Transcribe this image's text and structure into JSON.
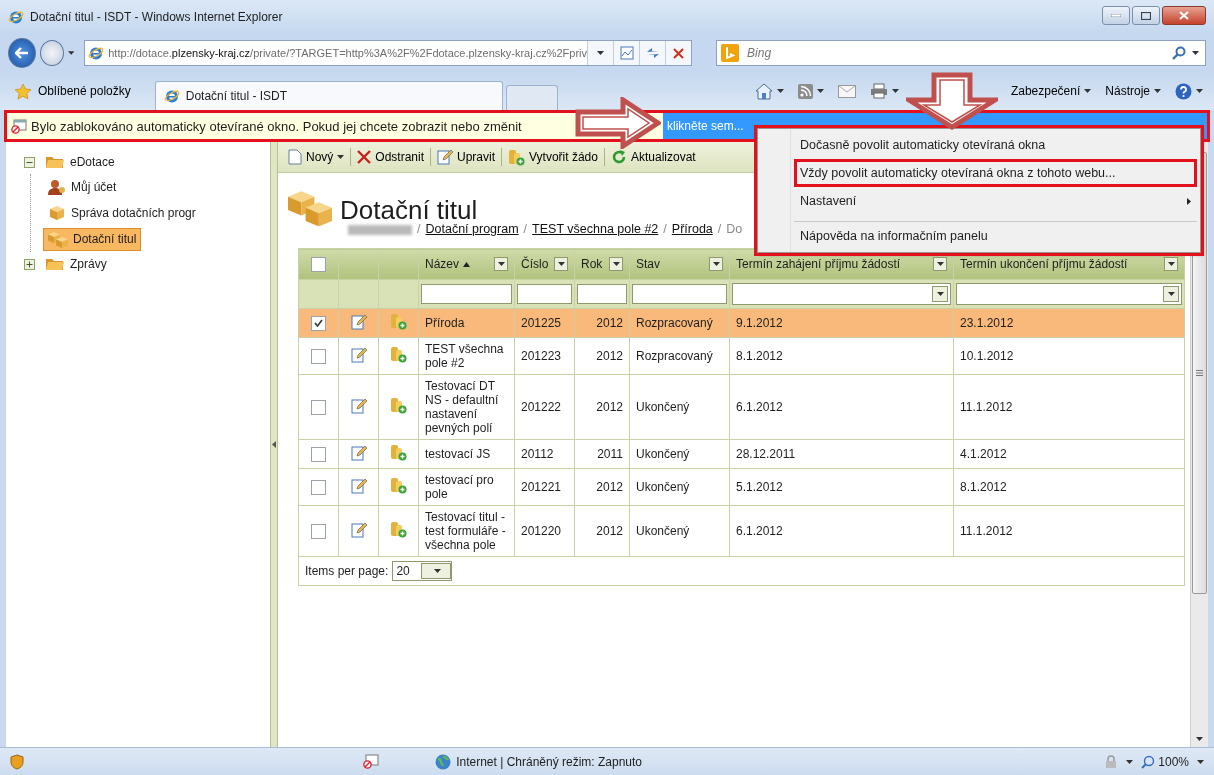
{
  "window": {
    "title": "Dotační titul - ISDT - Windows Internet Explorer"
  },
  "address_bar": {
    "url": "http://dotace.**plzensky-kraj.cz**/private/?TARGET=http%3A%2F%2Fdotace.plzensky-kraj.cz%2Fpriv"
  },
  "search": {
    "placeholder": "Bing"
  },
  "favorites": {
    "label": "Oblíbené položky"
  },
  "tabs": [
    {
      "label": "Dotační titul - ISDT",
      "selected": true
    }
  ],
  "command_bar": [
    {
      "label": "Zabezpečení"
    },
    {
      "label": "Nástroje"
    }
  ],
  "info_bar": {
    "outlined": true,
    "pointer_arrow": true,
    "message": "Bylo zablokováno automaticky otevírané okno. Pokud jej chcete zobrazit nebo změnit",
    "link": "klikněte sem..."
  },
  "context_menu": {
    "outlined": true,
    "pointer_arrow": true,
    "items": [
      {
        "label": "Dočasně povolit automaticky otevíraná okna",
        "marked": false,
        "submenu": false,
        "separator_before": false
      },
      {
        "label": "Vždy povolit automaticky otevíraná okna z tohoto webu...",
        "marked": true,
        "submenu": false,
        "separator_before": false
      },
      {
        "label": "Nastavení",
        "marked": false,
        "submenu": true,
        "separator_before": false
      },
      {
        "label": "Nápověda na informačním panelu",
        "marked": false,
        "submenu": false,
        "separator_before": true
      }
    ]
  },
  "sidebar": {
    "tree": [
      {
        "label": "eDotace",
        "kind": "folder",
        "expanded": true,
        "selected": false,
        "children": [
          {
            "label": "Můj účet",
            "kind": "user",
            "selected": false
          },
          {
            "label": "Správa dotačních progr",
            "kind": "package",
            "selected": false
          },
          {
            "label": "Dotační titul",
            "kind": "packages",
            "selected": true
          }
        ]
      },
      {
        "label": "Zprávy",
        "kind": "folder",
        "expanded": false,
        "selected": false
      }
    ]
  },
  "toolbar": [
    {
      "label": "Nový",
      "kind": "new",
      "dropdown": true
    },
    {
      "label": "Odstranit",
      "kind": "delete",
      "dropdown": false
    },
    {
      "label": "Upravit",
      "kind": "edit",
      "dropdown": false
    },
    {
      "label": "Vytvořit žádo",
      "kind": "create",
      "dropdown": false
    },
    {
      "label": "Aktualizovat",
      "kind": "refresh",
      "dropdown": false
    }
  ],
  "page": {
    "title": "Dotační titul",
    "separator": "/",
    "breadcrumb": [
      {
        "kind": "redacted"
      },
      {
        "kind": "link",
        "label": "Dotační program"
      },
      {
        "kind": "link",
        "label": "TEST všechna pole #2"
      },
      {
        "kind": "link",
        "label": "Příroda"
      },
      {
        "kind": "current",
        "label": "Do"
      }
    ]
  },
  "table": {
    "header_checkbox": {
      "checked": false
    },
    "columns": [
      {
        "label": "Název",
        "sorted_ascending": true,
        "filter_dropdown": false
      },
      {
        "label": "Číslo",
        "sorted_ascending": false,
        "filter_dropdown": false
      },
      {
        "label": "Rok",
        "sorted_ascending": false,
        "filter_dropdown": false
      },
      {
        "label": "Stav",
        "sorted_ascending": false,
        "filter_dropdown": false
      },
      {
        "label": "Termín zahájení příjmu žádostí",
        "sorted_ascending": false,
        "filter_dropdown": true
      },
      {
        "label": "Termín ukončení příjmu žádostí",
        "sorted_ascending": false,
        "filter_dropdown": true
      }
    ],
    "rows": [
      {
        "selected": true,
        "checked": true,
        "cells": [
          "Příroda",
          "201225",
          "2012",
          "Rozpracovaný",
          "9.1.2012",
          "23.1.2012"
        ]
      },
      {
        "selected": false,
        "checked": false,
        "cells": [
          "TEST všechna pole #2",
          "201223",
          "2012",
          "Rozpracovaný",
          "8.1.2012",
          "10.1.2012"
        ]
      },
      {
        "selected": false,
        "checked": false,
        "cells": [
          "Testovací DT NS - defaultní nastavení pevných polí",
          "201222",
          "2012",
          "Ukončený",
          "6.1.2012",
          "11.1.2012"
        ]
      },
      {
        "selected": false,
        "checked": false,
        "cells": [
          "testovací JS",
          "20112",
          "2011",
          "Ukončený",
          "28.12.2011",
          "4.1.2012"
        ]
      },
      {
        "selected": false,
        "checked": false,
        "cells": [
          "testovací pro pole",
          "201221",
          "2012",
          "Ukončený",
          "5.1.2012",
          "8.1.2012"
        ]
      },
      {
        "selected": false,
        "checked": false,
        "cells": [
          "Testovací titul - test formuláře - všechna pole",
          "201220",
          "2012",
          "Ukončený",
          "6.1.2012",
          "11.1.2012"
        ]
      }
    ]
  },
  "pager": {
    "label": "Items per page:",
    "value": "20"
  },
  "status_bar": {
    "zone": "Internet | Chráněný režim: Zapnuto",
    "zoom": "100%"
  }
}
